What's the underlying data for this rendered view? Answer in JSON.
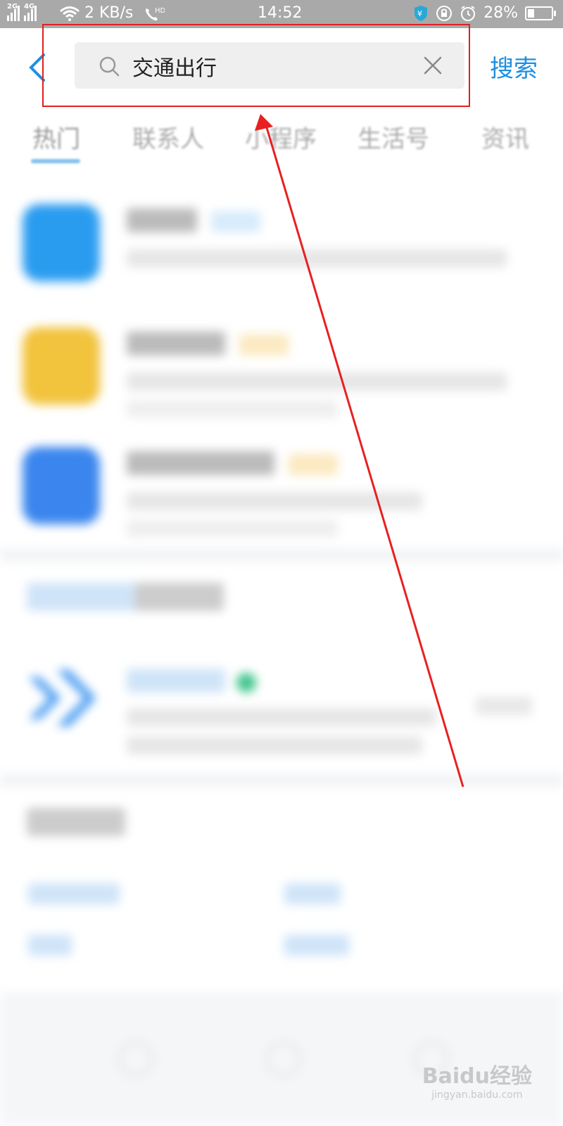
{
  "status_bar": {
    "network_1": "2G",
    "network_2": "4G",
    "speed": "2 KB/s",
    "call_badge": "HD",
    "time": "14:52",
    "battery": "28%",
    "battery_level": 0.28,
    "icons": [
      "signal-icon",
      "wifi-icon",
      "hd-call-icon",
      "shield-icon",
      "lock-icon",
      "alarm-icon",
      "battery-icon"
    ]
  },
  "header": {
    "back_icon": "chevron-left-icon",
    "search_value": "交通出行",
    "search_icon": "search-icon",
    "clear_icon": "close-icon",
    "search_button": "搜索"
  },
  "tabs": [
    {
      "label": "热门",
      "active": true
    },
    {
      "label": "联系人"
    },
    {
      "label": "小程序"
    },
    {
      "label": "生活号"
    },
    {
      "label": "资讯"
    }
  ],
  "colors": {
    "accent": "#1e8fe0",
    "annotation_red": "#e02020",
    "status_bar_bg": "#a9a9a9"
  },
  "watermark": {
    "logo": "Baidu经验",
    "sub": "jingyan.baidu.com"
  }
}
